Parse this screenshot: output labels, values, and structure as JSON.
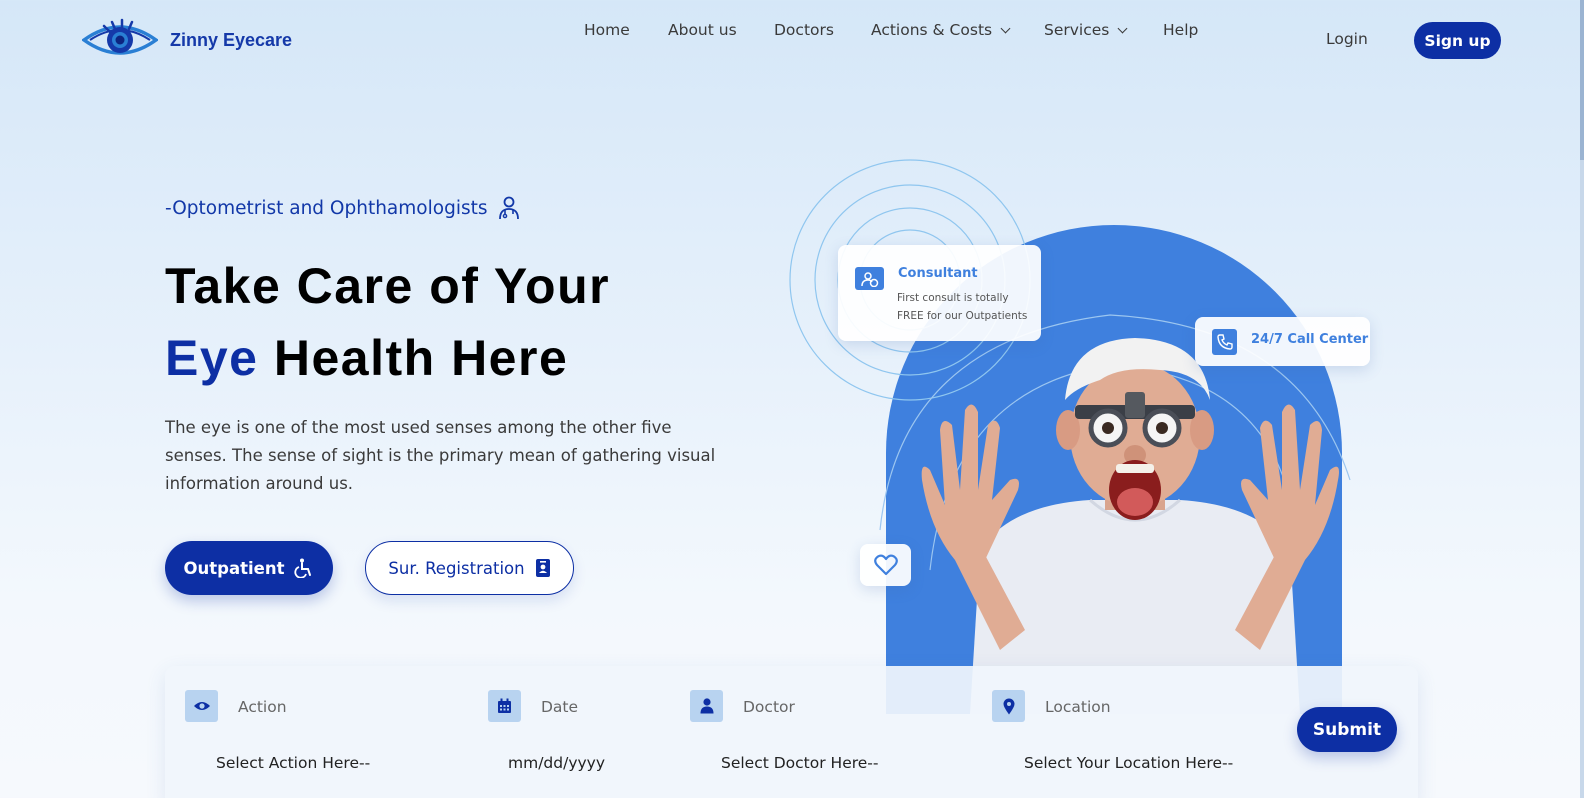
{
  "brand": {
    "name": "Zinny Eyecare",
    "logo_icon": "eye-icon"
  },
  "nav": {
    "items": [
      "Home",
      "About us",
      "Doctors",
      "Actions & Costs",
      "Services",
      "Help"
    ],
    "login_label": "Login",
    "signup_label": "Sign up"
  },
  "hero": {
    "tagline": "-Optometrist and Ophthamologists",
    "headline_line1": "Take Care of Your",
    "headline_accent": "Eye",
    "headline_rest": "Health Here",
    "description": "The eye is one of the most used senses among the other five senses. The sense of sight is the primary mean of gathering visual information around us.",
    "primary_button": "Outpatient",
    "secondary_button": "Sur. Registration"
  },
  "cards": {
    "consultant_title": "Consultant",
    "consultant_text": "First consult is totally FREE for our Outpatients",
    "call_center": "24/7 Call Center"
  },
  "booking": {
    "fields": [
      {
        "label": "Action",
        "value": "Select Action Here--",
        "icon": "eye-icon"
      },
      {
        "label": "Date",
        "value": "mm/dd/yyyy",
        "icon": "calendar-icon"
      },
      {
        "label": "Doctor",
        "value": "Select Doctor Here--",
        "icon": "user-icon"
      },
      {
        "label": "Location",
        "value": "Select Your Location Here--",
        "icon": "location-pin-icon"
      }
    ],
    "submit_label": "Submit"
  },
  "colors": {
    "primary": "#0d2fa4",
    "accent": "#3f80de",
    "icon_bg": "#b8d3f0"
  }
}
